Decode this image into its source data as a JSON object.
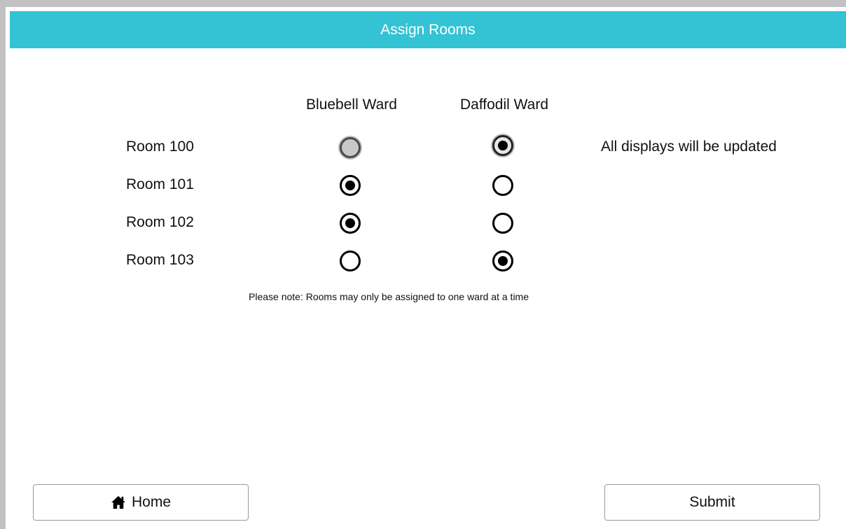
{
  "header": {
    "title": "Assign Rooms"
  },
  "columns": [
    {
      "label": "Bluebell Ward"
    },
    {
      "label": "Daffodil Ward"
    }
  ],
  "rooms": [
    {
      "label": "Room 100",
      "selection": "Daffodil Ward",
      "bluebell_state": "disabled",
      "daffodil_state": "disabled-checked"
    },
    {
      "label": "Room 101",
      "selection": "Bluebell Ward",
      "bluebell_state": "checked",
      "daffodil_state": "unchecked"
    },
    {
      "label": "Room 102",
      "selection": "Bluebell Ward",
      "bluebell_state": "checked",
      "daffodil_state": "unchecked"
    },
    {
      "label": "Room 103",
      "selection": "Daffodil Ward",
      "bluebell_state": "unchecked",
      "daffodil_state": "checked"
    }
  ],
  "info": {
    "room100_message": "All displays will be updated"
  },
  "note": "Please note: Rooms may only be assigned to one ward at a time",
  "footer": {
    "home_label": "Home",
    "submit_label": "Submit"
  },
  "colors": {
    "header_bg": "#33c3d4",
    "header_text": "#ffffff",
    "outer_bg": "#c2c2c2"
  },
  "icons": {
    "home": "home-icon"
  }
}
